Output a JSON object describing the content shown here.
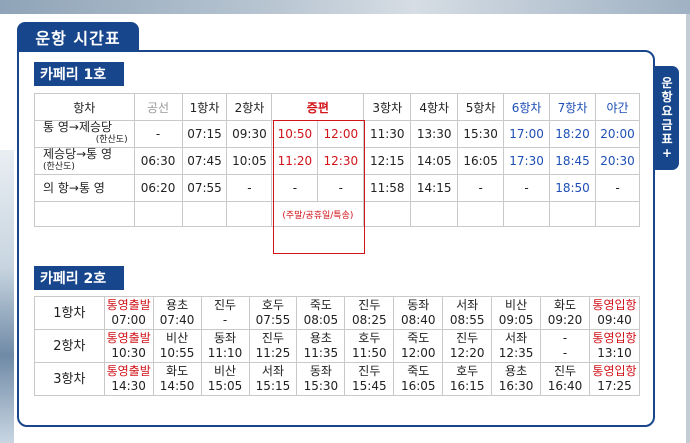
{
  "page": {
    "title": "운항 시간표",
    "side_tab": [
      "운",
      "항",
      "요",
      "금",
      "표",
      "+"
    ]
  },
  "ferry1": {
    "name": "카페리 1호",
    "headers": [
      "항차",
      "공선",
      "1항차",
      "2항차",
      "증편",
      "",
      "3항차",
      "4항차",
      "5항차",
      "6항차",
      "7항차",
      "야간"
    ],
    "rows": [
      {
        "route": "통  영→제승당",
        "sub": "(한산도)",
        "times": [
          "-",
          "07:15",
          "09:30",
          "10:50",
          "12:00",
          "11:30",
          "13:30",
          "15:30",
          "17:00",
          "18:20",
          "20:00"
        ]
      },
      {
        "route": "제승당→통  영",
        "sub": "(한산도)",
        "times": [
          "06:30",
          "07:45",
          "10:05",
          "11:20",
          "12:30",
          "12:15",
          "14:05",
          "16:05",
          "17:30",
          "18:45",
          "20:30"
        ]
      },
      {
        "route": "의  항→통  영",
        "sub": "",
        "times": [
          "06:20",
          "07:55",
          "-",
          "-",
          "-",
          "11:58",
          "14:15",
          "-",
          "-",
          "18:50",
          "-"
        ]
      }
    ],
    "note": "(주말/공휴일/특송)"
  },
  "ferry2": {
    "name": "카페리 2호",
    "rows": [
      {
        "label": "1항차",
        "stops": [
          "통영출발",
          "용초",
          "진두",
          "호두",
          "죽도",
          "진두",
          "동좌",
          "서좌",
          "비산",
          "화도",
          "통영입항"
        ],
        "times": [
          "07:00",
          "07:40",
          "-",
          "07:55",
          "08:05",
          "08:25",
          "08:40",
          "08:55",
          "09:05",
          "09:20",
          "09:40"
        ]
      },
      {
        "label": "2항차",
        "stops": [
          "통영출발",
          "비산",
          "동좌",
          "진두",
          "용초",
          "호두",
          "죽도",
          "진두",
          "서좌",
          "-",
          "통영입항"
        ],
        "times": [
          "10:30",
          "10:55",
          "11:10",
          "11:25",
          "11:35",
          "11:50",
          "12:00",
          "12:20",
          "12:35",
          "-",
          "13:10"
        ]
      },
      {
        "label": "3항차",
        "stops": [
          "통영출발",
          "화도",
          "비산",
          "서좌",
          "동좌",
          "진두",
          "죽도",
          "호두",
          "용초",
          "진두",
          "통영입항"
        ],
        "times": [
          "14:30",
          "14:50",
          "15:05",
          "15:15",
          "15:30",
          "15:45",
          "16:05",
          "16:15",
          "16:30",
          "16:40",
          "17:25"
        ]
      }
    ]
  },
  "colors": {
    "navy": "#17468c",
    "red": "#d1131a",
    "blue": "#1e4fb5"
  }
}
